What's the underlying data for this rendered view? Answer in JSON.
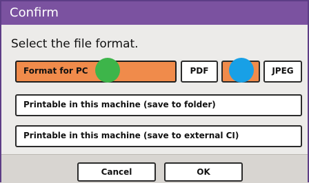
{
  "dialog": {
    "title": "Confirm",
    "prompt": "Select the file format."
  },
  "format_options": {
    "pc_label": "Format for PC",
    "pdf_label": "PDF",
    "third_label": "",
    "jpeg_label": "JPEG"
  },
  "options": {
    "save_to_folder": "Printable in this machine (save to folder)",
    "save_to_external": "Printable in this machine (save to external CI)"
  },
  "footer": {
    "cancel_label": "Cancel",
    "ok_label": "OK"
  },
  "colors": {
    "title_bar": "#7b52a0",
    "selected": "#f08b4b",
    "marker_green": "#3db54a",
    "marker_blue": "#18a0e6"
  }
}
